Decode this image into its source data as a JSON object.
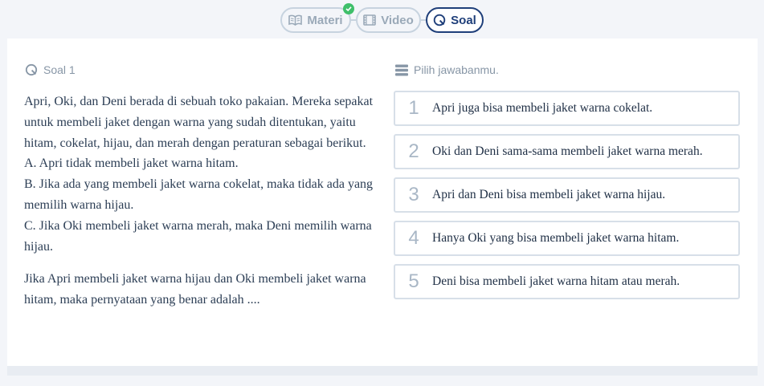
{
  "tabs": {
    "materi": {
      "label": "Materi",
      "completed": true
    },
    "video": {
      "label": "Video"
    },
    "soal": {
      "label": "Soal",
      "active": true
    }
  },
  "question": {
    "header": "Soal 1",
    "lines": [
      "Apri, Oki, dan Deni berada di sebuah toko pakaian. Mereka sepakat untuk membeli jaket dengan warna yang sudah ditentukan, yaitu hitam, cokelat, hijau, dan merah dengan peraturan sebagai berikut.",
      "A. Apri tidak membeli jaket warna hitam.",
      "B. Jika ada yang membeli jaket warna cokelat, maka tidak ada yang memilih warna hijau.",
      "C. Jika Oki membeli jaket warna merah, maka Deni memilih warna hijau."
    ],
    "prompt": "Jika Apri membeli jaket warna hijau dan Oki membeli jaket warna hitam, maka pernyataan yang benar adalah ...."
  },
  "answers": {
    "header": "Pilih jawabanmu.",
    "options": [
      {
        "number": "1",
        "text": "Apri juga bisa membeli jaket warna cokelat."
      },
      {
        "number": "2",
        "text": "Oki dan Deni sama-sama membeli jaket warna merah."
      },
      {
        "number": "3",
        "text": "Apri dan Deni bisa membeli jaket warna hijau."
      },
      {
        "number": "4",
        "text": "Hanya Oki yang bisa membeli jaket warna hitam."
      },
      {
        "number": "5",
        "text": "Deni bisa membeli jaket warna hitam atau merah."
      }
    ]
  },
  "icons": {
    "materi": "book-icon",
    "video": "film-icon",
    "soal": "question-icon",
    "list": "list-icon",
    "check": "check-icon"
  },
  "colors": {
    "active": "#1f3f7a",
    "inactive": "#9aa9b8",
    "completed": "#3fbf6a"
  }
}
